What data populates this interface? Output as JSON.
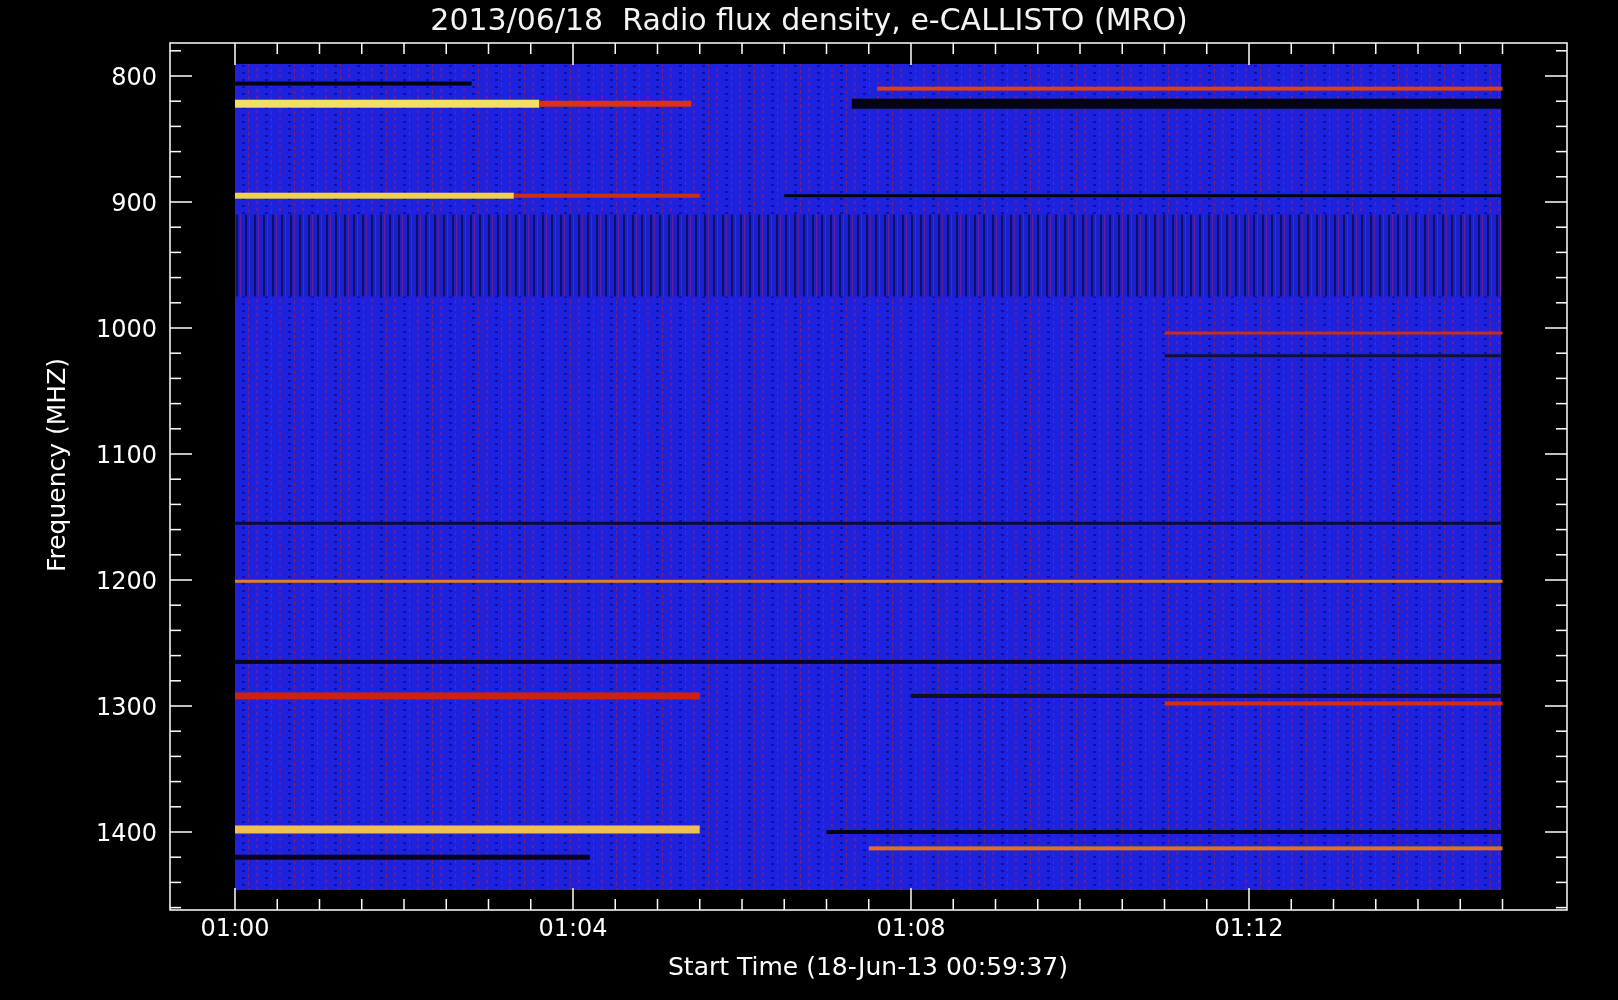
{
  "title": "2013/06/18  Radio flux density, e-CALLISTO (MRO)",
  "y_axis": {
    "label": "Frequency (MHZ)",
    "ticks": [
      "800",
      "900",
      "1000",
      "1100",
      "1200",
      "1300",
      "1400"
    ]
  },
  "x_axis": {
    "label": "Start Time (18-Jun-13 00:59:37)",
    "ticks": [
      "01:00",
      "01:04",
      "01:08",
      "01:12"
    ]
  }
}
